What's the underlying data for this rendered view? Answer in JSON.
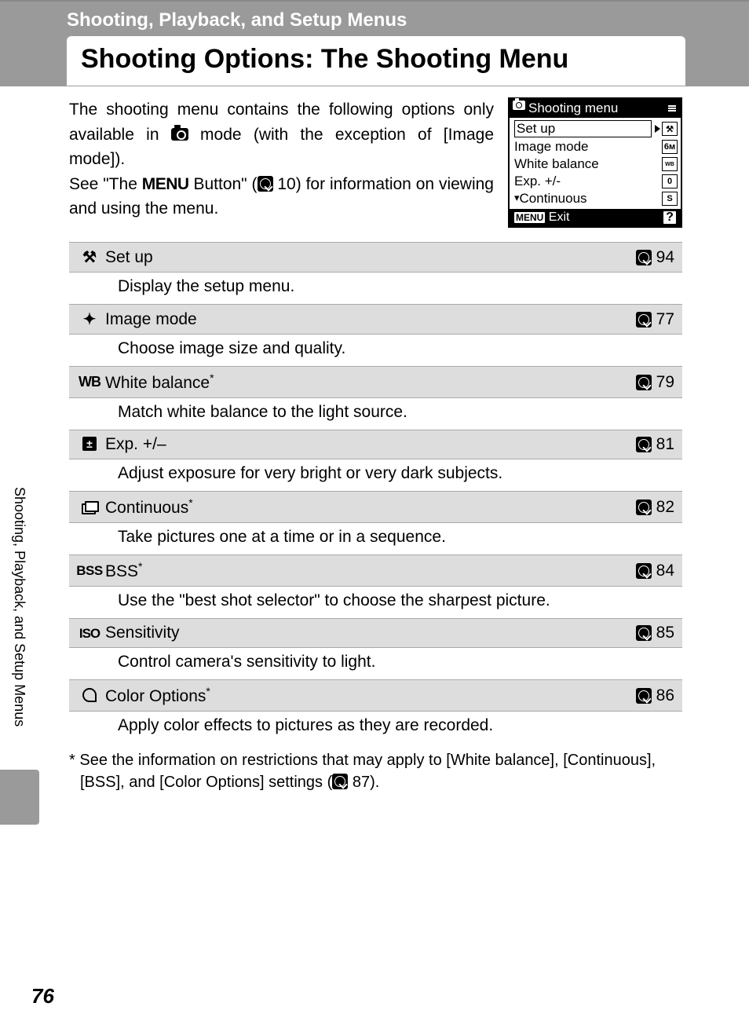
{
  "header": {
    "chapter": "Shooting, Playback, and Setup Menus",
    "title": "Shooting Options: The Shooting Menu"
  },
  "intro": {
    "p1a": "The shooting menu contains the following options only available in ",
    "p1b": " mode (with the exception of [Image mode]).",
    "p2a": "See \"The ",
    "p2menu": "MENU",
    "p2b": " Button\" (",
    "p2ref": "10",
    "p2c": ") for information on viewing and using the menu."
  },
  "lcd": {
    "title": "Shooting menu",
    "items": [
      {
        "label": "Set up",
        "badge": "⚒",
        "selected": true
      },
      {
        "label": "Image mode",
        "badge": "6ᴍ"
      },
      {
        "label": "White balance",
        "badge": "WB"
      },
      {
        "label": "Exp. +/-",
        "badge": "0"
      },
      {
        "label": "Continuous",
        "badge": "S",
        "arrow": true
      }
    ],
    "foot_menu": "MENU",
    "foot_exit": "Exit",
    "foot_help": "?"
  },
  "options": [
    {
      "icon": "setup",
      "title": "Set up",
      "star": false,
      "page": "94",
      "desc": "Display the setup menu."
    },
    {
      "icon": "img",
      "title": "Image mode",
      "star": false,
      "page": "77",
      "desc": "Choose image size and quality."
    },
    {
      "icon": "wb",
      "title": "White balance",
      "star": true,
      "page": "79",
      "desc": "Match white balance to the light source."
    },
    {
      "icon": "exp",
      "title": "Exp. +/–",
      "star": false,
      "page": "81",
      "desc": "Adjust exposure for very bright or very dark subjects."
    },
    {
      "icon": "cont",
      "title": "Continuous",
      "star": true,
      "page": "82",
      "desc": "Take pictures one at a time or in a sequence."
    },
    {
      "icon": "bss",
      "title": "BSS",
      "star": true,
      "page": "84",
      "desc": "Use the \"best shot selector\" to choose the sharpest picture."
    },
    {
      "icon": "iso",
      "title": "Sensitivity",
      "star": false,
      "page": "85",
      "desc": "Control camera's sensitivity to light."
    },
    {
      "icon": "color",
      "title": "Color Options",
      "star": true,
      "page": "86",
      "desc": "Apply color effects to pictures as they are recorded."
    }
  ],
  "footnote": {
    "mark": "*",
    "text_a": "See the information on restrictions that may apply to [White balance], [Continuous], [BSS], and [Color Options] settings (",
    "ref": "87",
    "text_b": ")."
  },
  "side_tab": "Shooting, Playback, and Setup Menus",
  "page_number": "76"
}
